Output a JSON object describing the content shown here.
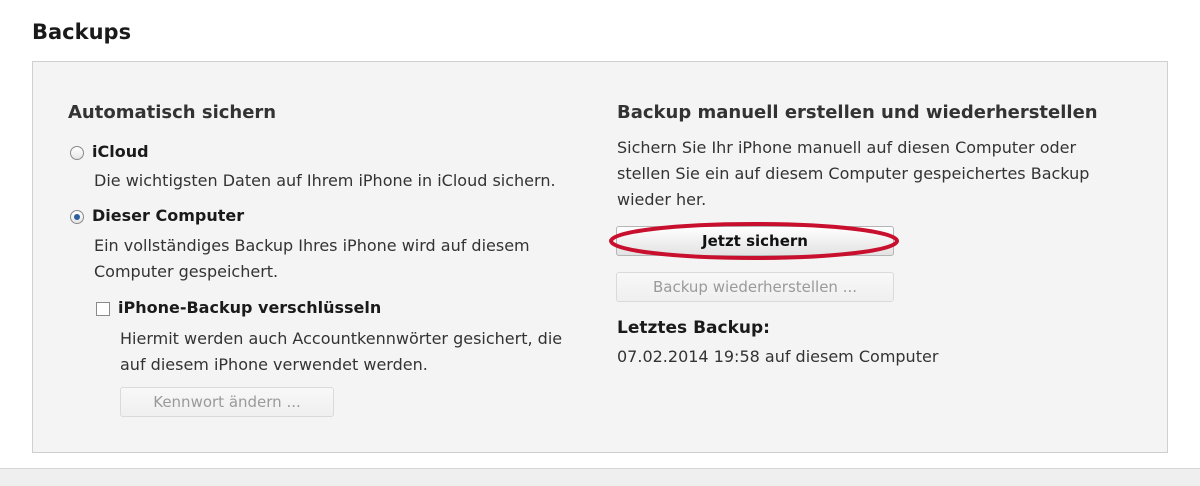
{
  "section": {
    "title": "Backups"
  },
  "auto_backup": {
    "heading": "Automatisch sichern",
    "options": [
      {
        "label": "iCloud",
        "description": "Die wichtigsten Daten auf Ihrem iPhone in iCloud sichern.",
        "selected": false
      },
      {
        "label": "Dieser Computer",
        "description_lines": [
          "Ein vollständiges Backup Ihres iPhone wird auf diesem",
          "Computer gespeichert."
        ],
        "selected": true
      }
    ],
    "encrypt": {
      "label": "iPhone-Backup verschlüsseln",
      "checked": false,
      "description_lines": [
        "Hiermit werden auch Accountkennwörter gesichert, die",
        "auf diesem iPhone verwendet werden."
      ]
    },
    "change_password_label": "Kennwort ändern ..."
  },
  "manual_backup": {
    "heading": "Backup manuell erstellen und wiederherstellen",
    "description_lines": [
      "Sichern Sie Ihr iPhone manuell auf diesen Computer oder",
      "stellen Sie ein auf diesem Computer gespeichertes Backup",
      "wieder her."
    ],
    "backup_now_label": "Jetzt sichern",
    "restore_label": "Backup wiederherstellen ...",
    "last_backup_heading": "Letztes Backup:",
    "last_backup_value": "07.02.2014 19:58 auf diesem Computer"
  },
  "colors": {
    "highlight": "#c8102e",
    "radio_selected": "#2b5f9e"
  }
}
